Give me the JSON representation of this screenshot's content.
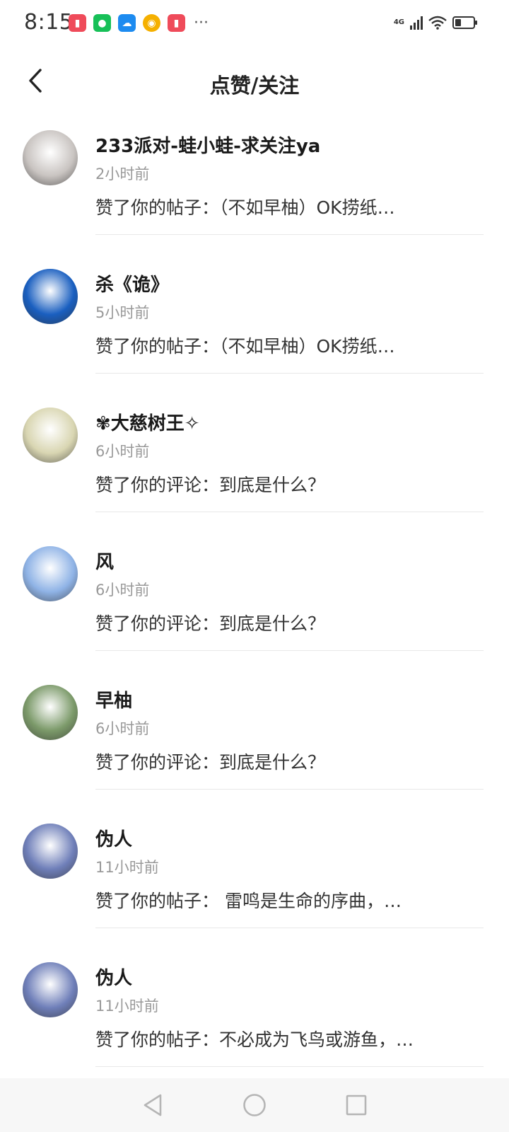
{
  "status_bar": {
    "time": "8:15",
    "network": "4G",
    "battery_level": 0.35,
    "notification_icons": [
      "red-app-icon",
      "wechat-icon",
      "weather-icon",
      "weibo-icon",
      "red-app-icon"
    ],
    "more": "···"
  },
  "header": {
    "title": "点赞/关注",
    "back_icon": "chevron-left-icon"
  },
  "items": [
    {
      "name": "233派对-蛙小蛙-求关注ya",
      "time": "2小时前",
      "message": "赞了你的帖子：（不如早柚）OK捞纸…",
      "avatar_color": "#c9c4c1"
    },
    {
      "name": "杀《诡》",
      "time": "5小时前",
      "message": "赞了你的帖子：（不如早柚）OK捞纸…",
      "avatar_color": "#1a5fc0"
    },
    {
      "name": "✾大慈树王✧",
      "time": "6小时前",
      "message": "赞了你的评论：到底是什么？",
      "avatar_color": "#d9d6b2"
    },
    {
      "name": "风",
      "time": "6小时前",
      "message": "赞了你的评论：到底是什么？",
      "avatar_color": "#8fb3e6"
    },
    {
      "name": "早柚",
      "time": "6小时前",
      "message": "赞了你的评论：到底是什么？",
      "avatar_color": "#7c9a6a"
    },
    {
      "name": "伪人",
      "time": "11小时前",
      "message": "赞了你的帖子： 雷鸣是生命的序曲，…",
      "avatar_color": "#6f7fb9"
    },
    {
      "name": "伪人",
      "time": "11小时前",
      "message": "赞了你的帖子：不必成为飞鸟或游鱼，…",
      "avatar_color": "#6f7fb9"
    }
  ],
  "nav_bar": {
    "back_icon": "triangle-back-icon",
    "home_icon": "circle-home-icon",
    "recents_icon": "square-recents-icon"
  }
}
